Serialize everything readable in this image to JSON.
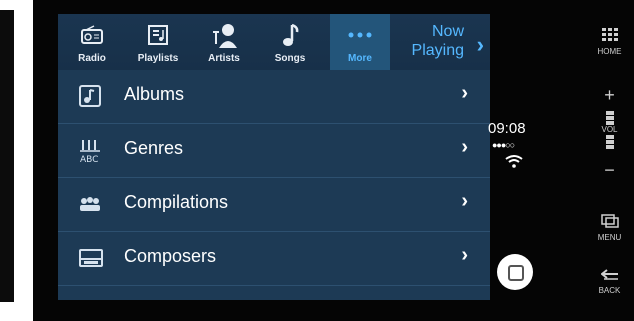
{
  "tabs": [
    {
      "label": "Radio",
      "icon": "radio-icon"
    },
    {
      "label": "Playlists",
      "icon": "playlist-icon"
    },
    {
      "label": "Artists",
      "icon": "artist-icon"
    },
    {
      "label": "Songs",
      "icon": "music-note-icon"
    },
    {
      "label": "More",
      "icon": "more-dots-icon",
      "active": true
    }
  ],
  "now_playing": {
    "line1": "Now",
    "line2": "Playing"
  },
  "list": [
    {
      "label": "Albums",
      "icon": "album-icon"
    },
    {
      "label": "Genres",
      "icon": "genres-icon"
    },
    {
      "label": "Compilations",
      "icon": "compilations-icon"
    },
    {
      "label": "Composers",
      "icon": "composers-icon"
    }
  ],
  "status": {
    "time": "09:08",
    "signal": "●●●○○"
  },
  "rail": {
    "home": "HOME",
    "vol": "VOL",
    "menu": "MENU",
    "back": "BACK",
    "plus": "+",
    "minus": "−"
  },
  "colors": {
    "accent": "#55b8ff",
    "screen_bg": "#1d3a55",
    "active_tab": "#23557a"
  }
}
